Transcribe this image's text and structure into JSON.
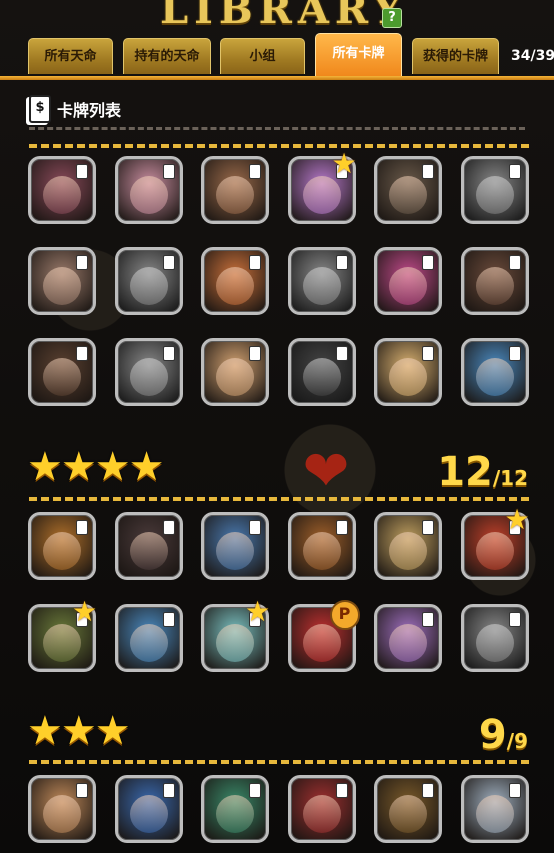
{
  "header": {
    "logo_text": "LIBRARY",
    "help_label": "?"
  },
  "tabs": [
    {
      "label": "所有天命",
      "active": false
    },
    {
      "label": "持有的天命",
      "active": false
    },
    {
      "label": "小组",
      "active": false
    },
    {
      "label": "所有卡牌",
      "active": true
    },
    {
      "label": "获得的卡牌",
      "active": false
    }
  ],
  "counter": "34/39",
  "section": {
    "title": "卡牌列表",
    "icon": "card-icon"
  },
  "ratings": {
    "four_star": {
      "stars": "★★★★",
      "count": "12",
      "total": "/12"
    },
    "three_star": {
      "stars": "★★★",
      "count": "9",
      "total": "/9"
    }
  },
  "icons": {
    "star": "★",
    "heart": "broken-heart-icon",
    "p_badge": "P"
  },
  "colors": {
    "accent": "#f0881c",
    "gold": "#e7b83c",
    "tab": "#b08a2e"
  },
  "grid_top": [
    {
      "c": "#8a4a5a",
      "owned": true
    },
    {
      "c": "#c98ea0",
      "owned": true
    },
    {
      "c": "#9a6a4a",
      "owned": true
    },
    {
      "c": "#b87acc",
      "owned": true,
      "badge": "star"
    },
    {
      "c": "#6a5a4a",
      "owned": true
    },
    {
      "c": "#888",
      "owned": false
    },
    {
      "c": "#9a7a6a",
      "owned": true
    },
    {
      "c": "#888",
      "owned": false
    },
    {
      "c": "#c9703a",
      "owned": true
    },
    {
      "c": "#888",
      "owned": false
    },
    {
      "c": "#c04a8a",
      "owned": true
    },
    {
      "c": "#6a4a3a",
      "owned": true
    },
    {
      "c": "#5a4030",
      "owned": true
    },
    {
      "c": "#888",
      "owned": false
    },
    {
      "c": "#d0a070",
      "owned": true
    },
    {
      "c": "#444",
      "owned": false
    },
    {
      "c": "#d8b070",
      "owned": true
    },
    {
      "c": "#4a8ac0",
      "owned": true
    }
  ],
  "grid_four": [
    {
      "c": "#b0702a",
      "owned": true
    },
    {
      "c": "#4a3a3a",
      "owned": true
    },
    {
      "c": "#4a7ab0",
      "owned": true
    },
    {
      "c": "#a0602a",
      "owned": true
    },
    {
      "c": "#c0a060",
      "owned": true
    },
    {
      "c": "#c0402a",
      "owned": true,
      "badge": "star"
    },
    {
      "c": "#6a7a3a",
      "owned": true,
      "badge": "star"
    },
    {
      "c": "#4a8ac0",
      "owned": true
    },
    {
      "c": "#7ac0c0",
      "owned": true,
      "badge": "star"
    },
    {
      "c": "#c03030",
      "owned": true,
      "badge": "p"
    },
    {
      "c": "#a070c0",
      "owned": true
    },
    {
      "c": "#888",
      "owned": false
    }
  ],
  "grid_three": [
    {
      "c": "#c08a5a",
      "owned": true
    },
    {
      "c": "#3a6ab0",
      "owned": true
    },
    {
      "c": "#3a8a6a",
      "owned": true
    },
    {
      "c": "#a03030",
      "owned": true
    },
    {
      "c": "#7a5a2a",
      "owned": true
    },
    {
      "c": "#a0b0c0",
      "owned": true
    }
  ]
}
